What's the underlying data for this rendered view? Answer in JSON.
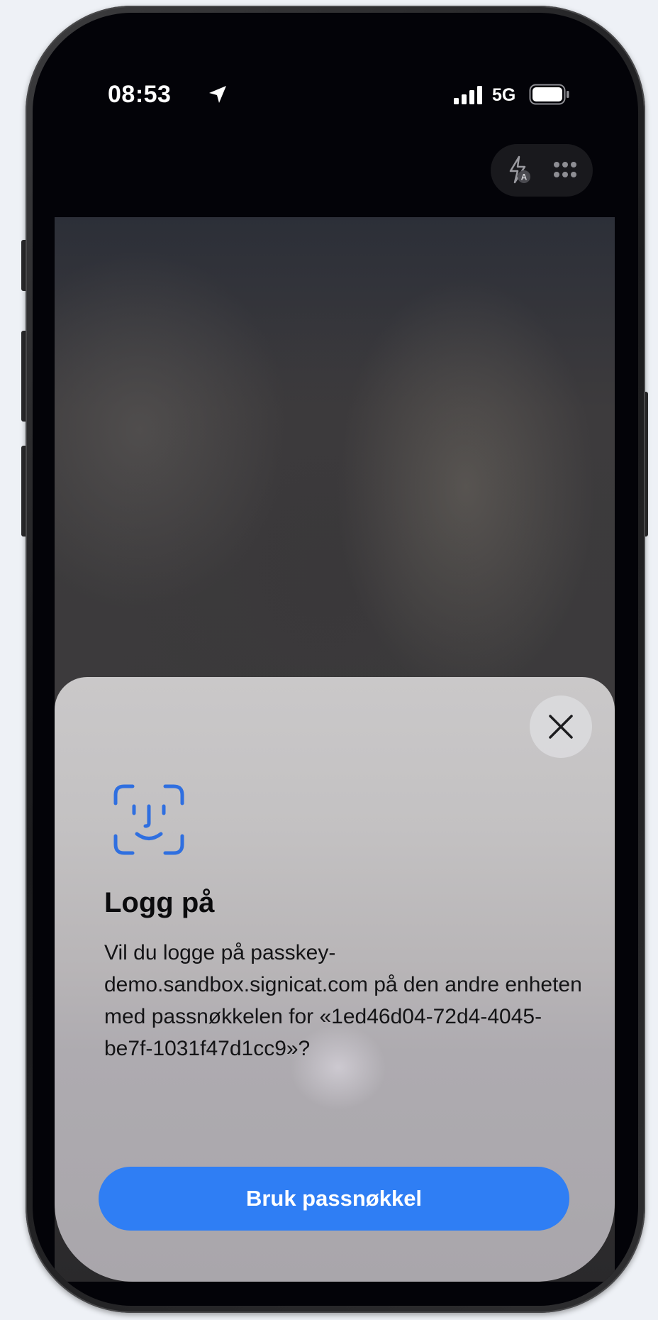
{
  "status_bar": {
    "time": "08:53",
    "network": "5G",
    "icons": [
      "location-arrow-icon",
      "signal-bars-icon",
      "battery-icon"
    ]
  },
  "camera_controls": {
    "icons": [
      "flash-auto-icon",
      "grid-menu-icon"
    ]
  },
  "sheet": {
    "title": "Logg på",
    "message": "Vil du logge på passkey-demo.sandbox.signicat.com på den andre enheten med passnøkkelen for «1ed46d04-72d4-4045-be7f-1031f47d1cc9»?",
    "primary_button": "Bruk passnøkkel",
    "icons": [
      "close-icon",
      "face-id-icon"
    ],
    "colors": {
      "accent": "#2f7ef4",
      "face_id": "#2f6fe0"
    }
  }
}
